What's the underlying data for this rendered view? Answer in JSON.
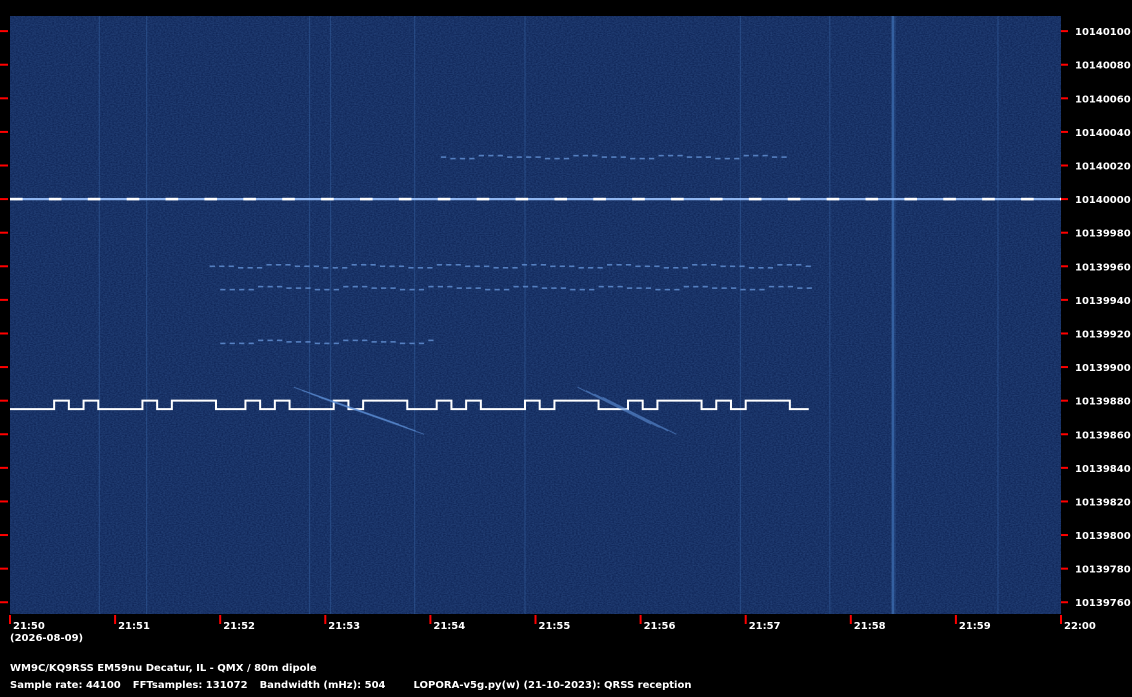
{
  "chart_data": {
    "type": "heatmap",
    "title": "",
    "caption": "WM9C/KQ9RSS EM59nu Decatur, IL - QMX / 80m dipole",
    "date_label": "(2026-08-09)",
    "sample_rate": "Sample rate: 44100",
    "fft_samples": "FFTsamples: 131072",
    "bandwidth": "Bandwidth (mHz): 504",
    "software": "LOPORA-v5g.py(w) (21-10-2023): QRSS reception",
    "x_ticks": [
      "21:50",
      "21:51",
      "21:52",
      "21:53",
      "21:54",
      "21:55",
      "21:56",
      "21:57",
      "21:58",
      "21:59",
      "22:00"
    ],
    "y_ticks": [
      10140100,
      10140080,
      10140060,
      10140040,
      10140020,
      10140000,
      10139980,
      10139960,
      10139940,
      10139920,
      10139900,
      10139880,
      10139860,
      10139840,
      10139820,
      10139800,
      10139780,
      10139760
    ],
    "xlim": [
      "21:50",
      "22:00"
    ],
    "ylim": [
      10139753,
      10140109
    ],
    "colors": {
      "background": "#0a1e4f",
      "signal": "#ffffff",
      "tick": "#ff0000",
      "noise_line": "#3d6fb3"
    },
    "signals": [
      {
        "name": "carrier",
        "freq": 10140000,
        "start_min": 0,
        "end_min": 10,
        "style": "steady"
      },
      {
        "name": "fsk_trace",
        "freq_low": 10139875,
        "freq_high": 10139880,
        "start_min": 0,
        "end_min": 7.6,
        "style": "fsk"
      },
      {
        "name": "faint_fsk_1",
        "freq": 10140025,
        "start_min": 4.1,
        "end_min": 7.4,
        "style": "faint"
      },
      {
        "name": "faint_fsk_2",
        "freq": 10139960,
        "start_min": 1.9,
        "end_min": 7.6,
        "style": "faint"
      },
      {
        "name": "faint_fsk_3",
        "freq": 10139947,
        "start_min": 2.0,
        "end_min": 7.6,
        "style": "faint"
      },
      {
        "name": "faint_fsk_4",
        "freq": 10139915,
        "start_min": 2.0,
        "end_min": 4.0,
        "style": "faint"
      }
    ]
  }
}
